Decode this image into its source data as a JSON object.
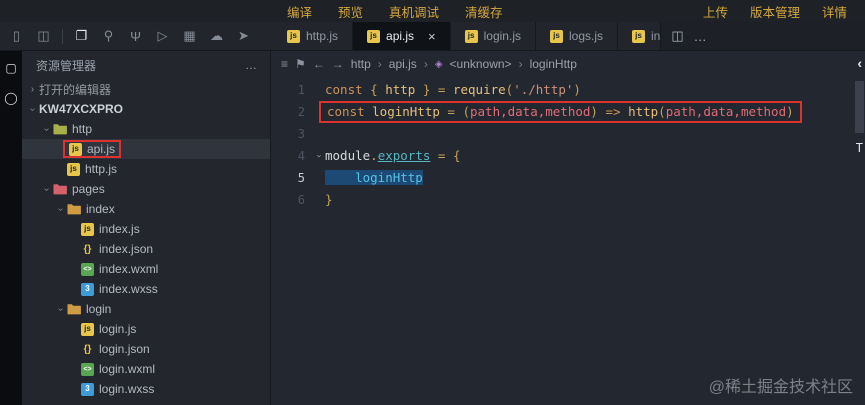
{
  "topbar": {
    "left": [
      "编译",
      "预览",
      "真机调试",
      "清缓存"
    ],
    "right": [
      "上传",
      "版本管理",
      "详情"
    ]
  },
  "activity_icons": [
    {
      "name": "device-icon",
      "glyph": "▯"
    },
    {
      "name": "simulator-panel-icon",
      "glyph": "◫"
    },
    {
      "name": "divider",
      "glyph": ""
    },
    {
      "name": "explorer-icon",
      "glyph": "❐",
      "active": true
    },
    {
      "name": "search-icon",
      "glyph": "⚲"
    },
    {
      "name": "git-branch-icon",
      "glyph": "Ψ"
    },
    {
      "name": "debug-icon",
      "glyph": "▷"
    },
    {
      "name": "extensions-icon",
      "glyph": "▦"
    },
    {
      "name": "cloud-icon",
      "glyph": "☁"
    },
    {
      "name": "deploy-icon",
      "glyph": "➤"
    }
  ],
  "strip_icons": [
    {
      "name": "panel-toggle-icon",
      "glyph": "▢"
    },
    {
      "name": "record-icon",
      "glyph": "◯"
    }
  ],
  "tabs": {
    "close_glyph": "×",
    "items": [
      {
        "label": "http.js",
        "active": false
      },
      {
        "label": "api.js",
        "active": true,
        "closable": true
      },
      {
        "label": "login.js",
        "active": false
      },
      {
        "label": "logs.js",
        "active": false
      },
      {
        "label": "in",
        "active": false,
        "truncated": true
      }
    ],
    "actions": [
      {
        "name": "split-editor-icon",
        "glyph": "◫"
      },
      {
        "name": "more-actions-icon",
        "glyph": "…"
      }
    ]
  },
  "sidebar": {
    "title": "资源管理器",
    "menu_glyph": "…",
    "tree": [
      {
        "label": "打开的编辑器",
        "depth": 0,
        "kind": "section",
        "chevron": "closed"
      },
      {
        "label": "KW47XCXPRO",
        "depth": 0,
        "kind": "root",
        "chevron": "open"
      },
      {
        "label": "http",
        "depth": 1,
        "kind": "folder",
        "color": "#a8b04a",
        "chevron": "open"
      },
      {
        "label": "api.js",
        "depth": 2,
        "kind": "file",
        "icon": "js",
        "selected": true,
        "red_box": true
      },
      {
        "label": "http.js",
        "depth": 2,
        "kind": "file",
        "icon": "js"
      },
      {
        "label": "pages",
        "depth": 1,
        "kind": "folder",
        "color": "#d5616b",
        "chevron": "open"
      },
      {
        "label": "index",
        "depth": 2,
        "kind": "folder",
        "color": "#cf9b43",
        "chevron": "open"
      },
      {
        "label": "index.js",
        "depth": 3,
        "kind": "file",
        "icon": "js"
      },
      {
        "label": "index.json",
        "depth": 3,
        "kind": "file",
        "icon": "json"
      },
      {
        "label": "index.wxml",
        "depth": 3,
        "kind": "file",
        "icon": "wxml"
      },
      {
        "label": "index.wxss",
        "depth": 3,
        "kind": "file",
        "icon": "wxss"
      },
      {
        "label": "login",
        "depth": 2,
        "kind": "folder",
        "color": "#cf9b43",
        "chevron": "open"
      },
      {
        "label": "login.js",
        "depth": 3,
        "kind": "file",
        "icon": "js"
      },
      {
        "label": "login.json",
        "depth": 3,
        "kind": "file",
        "icon": "json"
      },
      {
        "label": "login.wxml",
        "depth": 3,
        "kind": "file",
        "icon": "wxml"
      },
      {
        "label": "login.wxss",
        "depth": 3,
        "kind": "file",
        "icon": "wxss"
      }
    ]
  },
  "breadcrumb": {
    "separator": "›",
    "collapse_glyph": "‹",
    "nav_icons": [
      {
        "name": "outline-icon",
        "glyph": "≡"
      },
      {
        "name": "bookmark-icon",
        "glyph": "⚑"
      },
      {
        "name": "back-icon",
        "glyph": "←"
      },
      {
        "name": "forward-icon",
        "glyph": "→"
      }
    ],
    "items": [
      {
        "label": "http"
      },
      {
        "label": "api.js"
      },
      {
        "label": "<unknown>",
        "icon": "symbol-icon",
        "icon_glyph": "◈"
      },
      {
        "label": "loginHttp"
      }
    ]
  },
  "editor": {
    "scroll_deco": "T",
    "lines": [
      {
        "num": 1,
        "tokens": [
          [
            "const ",
            "kw"
          ],
          [
            "{ ",
            "gold"
          ],
          [
            "http",
            "var"
          ],
          [
            " } ",
            "gold"
          ],
          [
            "= ",
            "gold"
          ],
          [
            "require",
            "fn"
          ],
          [
            "(",
            "gold"
          ],
          [
            "'./http'",
            "str"
          ],
          [
            ")",
            "gold"
          ]
        ]
      },
      {
        "num": 2,
        "red_box": true,
        "tokens": [
          [
            "const ",
            "kw"
          ],
          [
            "loginHttp",
            "fn"
          ],
          [
            " = ",
            "gold"
          ],
          [
            "(",
            "gold"
          ],
          [
            "path,data,method",
            "param"
          ],
          [
            ") ",
            "gold"
          ],
          [
            "=> ",
            "kw"
          ],
          [
            "http",
            "fn"
          ],
          [
            "(",
            "gold"
          ],
          [
            "path,data,method",
            "param"
          ],
          [
            ")",
            "gold"
          ]
        ]
      },
      {
        "num": 3,
        "tokens": []
      },
      {
        "num": 4,
        "fold": true,
        "tokens": [
          [
            "module",
            "plain"
          ],
          [
            ".",
            "gold"
          ],
          [
            "exports",
            "link"
          ],
          [
            " = ",
            "gold"
          ],
          [
            "{",
            "gold"
          ]
        ]
      },
      {
        "num": 5,
        "current": true,
        "selection": true,
        "tokens": [
          [
            "    loginHttp",
            "cyan"
          ]
        ]
      },
      {
        "num": 6,
        "tokens": [
          [
            "}",
            "gold"
          ]
        ]
      }
    ]
  },
  "watermark": "@稀土掘金技术社区",
  "colors": {
    "annotation_red": "#dc3230",
    "accent_yellow": "#d4a73e",
    "selection_blue": "#1c4a74"
  }
}
